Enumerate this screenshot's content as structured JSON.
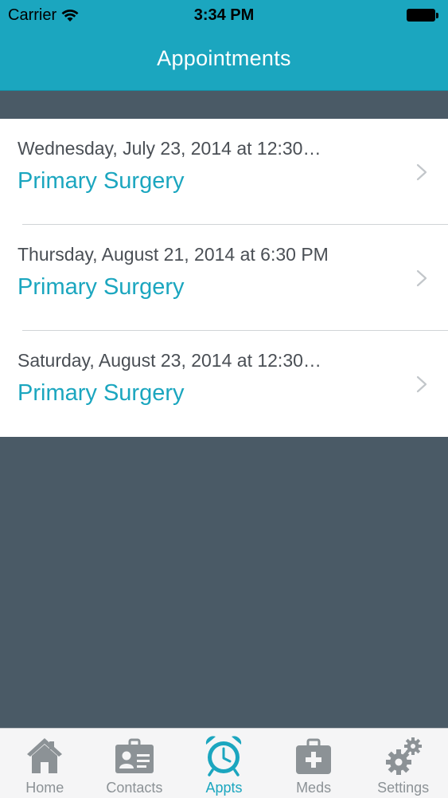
{
  "status_bar": {
    "carrier": "Carrier",
    "time": "3:34 PM"
  },
  "nav": {
    "title": "Appointments"
  },
  "appointments": [
    {
      "date": "Wednesday, July 23, 2014 at 12:30…",
      "place": "Primary Surgery"
    },
    {
      "date": "Thursday, August 21, 2014 at 6:30 PM",
      "place": "Primary Surgery"
    },
    {
      "date": "Saturday, August 23, 2014 at 12:30…",
      "place": "Primary Surgery"
    }
  ],
  "tabs": [
    {
      "label": "Home",
      "icon": "home-icon"
    },
    {
      "label": "Contacts",
      "icon": "contact-card-icon"
    },
    {
      "label": "Appts",
      "icon": "alarm-clock-icon",
      "active": true
    },
    {
      "label": "Meds",
      "icon": "medical-kit-icon"
    },
    {
      "label": "Settings",
      "icon": "gears-icon"
    }
  ],
  "colors": {
    "accent": "#1ba6bf",
    "background": "#4a5a66",
    "tab_inactive": "#8c9296"
  }
}
